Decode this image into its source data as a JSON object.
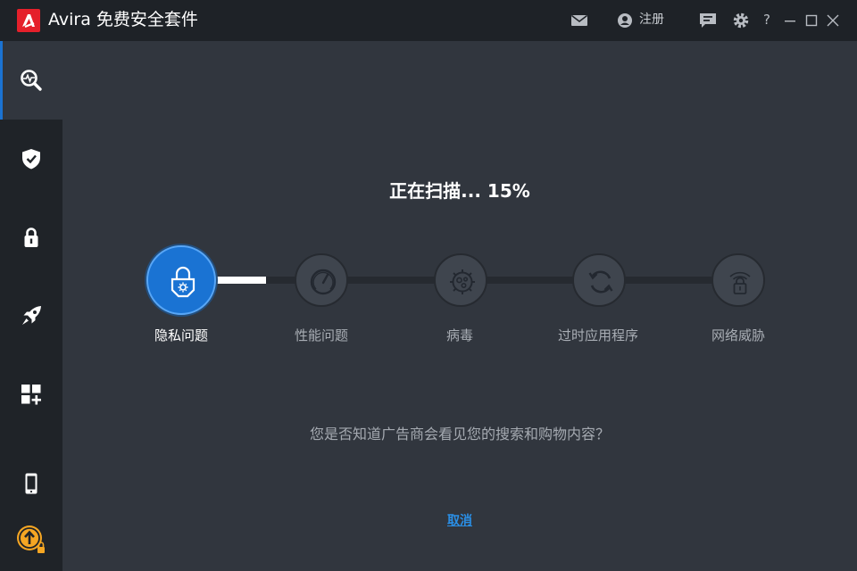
{
  "window": {
    "title": "Avira 免费安全套件",
    "register_label": "注册",
    "help_label": "?",
    "icons": [
      "mail-icon",
      "user-icon",
      "feedback-icon",
      "settings-icon",
      "help-icon",
      "minimize-icon",
      "maximize-icon",
      "close-icon"
    ]
  },
  "sidebar": {
    "items": [
      {
        "icon": "scan-icon",
        "active": true
      },
      {
        "icon": "shield-icon",
        "active": false
      },
      {
        "icon": "lock-icon",
        "active": false
      },
      {
        "icon": "rocket-icon",
        "active": false
      },
      {
        "icon": "apps-add-icon",
        "active": false
      },
      {
        "icon": "mobile-icon",
        "active": false
      },
      {
        "icon": "upgrade-icon",
        "active": false
      }
    ]
  },
  "scan": {
    "title": "正在扫描... 15%",
    "progress_percent": 15,
    "steps": [
      {
        "label": "隐私问题",
        "icon": "privacy-lock-icon",
        "active": true
      },
      {
        "label": "性能问题",
        "icon": "speedometer-icon",
        "active": false
      },
      {
        "label": "病毒",
        "icon": "virus-icon",
        "active": false
      },
      {
        "label": "过时应用程序",
        "icon": "update-icon",
        "active": false
      },
      {
        "label": "网络威胁",
        "icon": "network-lock-icon",
        "active": false
      }
    ],
    "tip": "您是否知道广告商会看见您的搜索和购物内容？",
    "cancel_label": "取消"
  },
  "colors": {
    "accent": "#1a73d3",
    "brand_red": "#e5202b",
    "link": "#2a8fe6",
    "background": "#31363e",
    "sidebar": "#1f2328"
  }
}
